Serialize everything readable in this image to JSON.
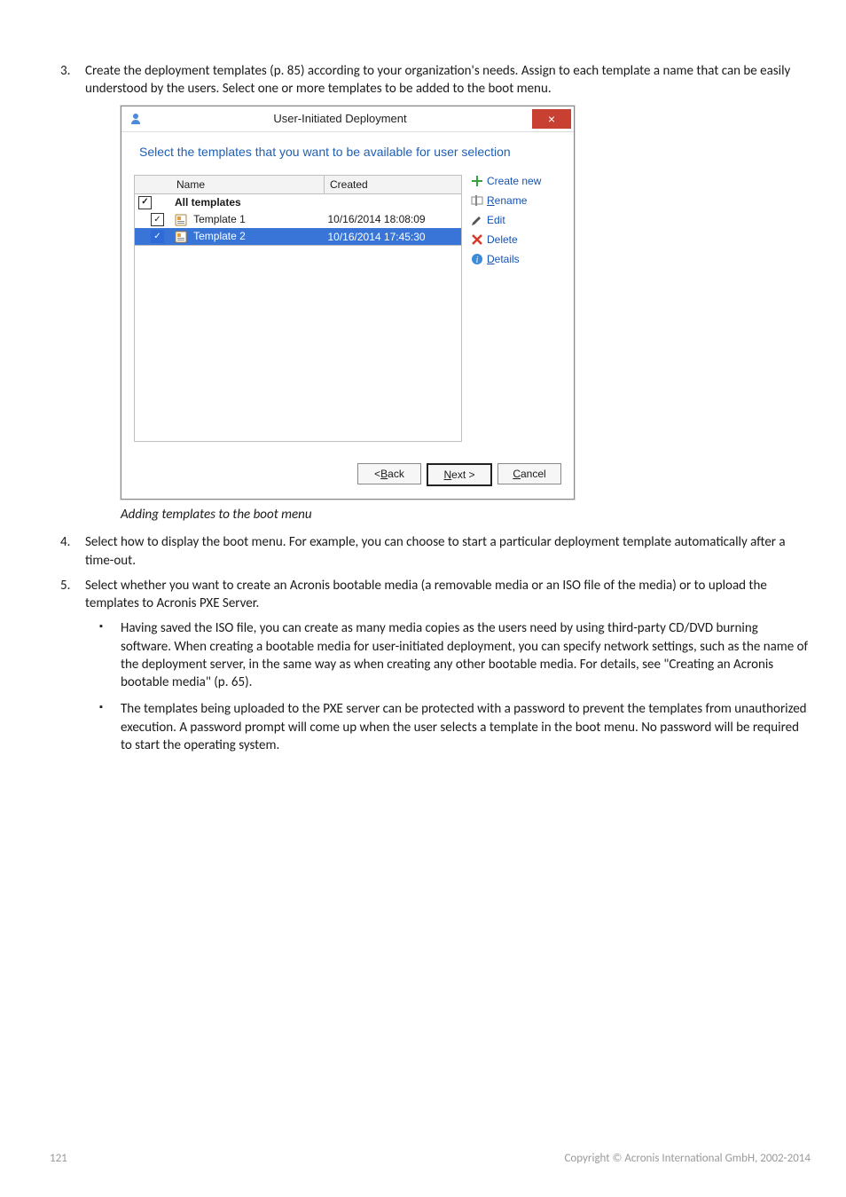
{
  "step3": {
    "num": "3.",
    "text": "Create the deployment templates (p. 85) according to your organization's needs. Assign to each template a name that can be easily understood by the users. Select one or more templates to be added to the boot menu."
  },
  "dialog": {
    "title": "User-Initiated Deployment",
    "closeGlyph": "×",
    "subtitle": "Select the templates that you want to be available for user selection",
    "headers": {
      "name": "Name",
      "created": "Created"
    },
    "rows": {
      "all": {
        "label": "All templates"
      },
      "r1": {
        "name": "Template 1",
        "created": "10/16/2014 18:08:09"
      },
      "r2": {
        "name": "Template 2",
        "created": "10/16/2014 17:45:30"
      }
    },
    "side": {
      "createnew": "Create new",
      "rename": "Rename",
      "edit": "Edit",
      "delete": "Delete",
      "details": "Details"
    },
    "buttons": {
      "back": "< Back",
      "next": "Next >",
      "cancel": "Cancel"
    }
  },
  "caption": "Adding templates to the boot menu",
  "step4": {
    "num": "4.",
    "text": "Select how to display the boot menu. For example, you can choose to start a particular deployment template automatically after a time-out."
  },
  "step5": {
    "num": "5.",
    "text": "Select whether you want to create an Acronis bootable media (a removable media or an ISO file of the media) or to upload the templates to Acronis PXE Server."
  },
  "bullets": {
    "b1": "Having saved the ISO file, you can create as many media copies as the users need by using third-party CD/DVD burning software. When creating a bootable media for user-initiated deployment, you can specify network settings, such as the name of the deployment server, in the same way as when creating any other bootable media. For details, see \"Creating an Acronis bootable media\" (p. 65).",
    "b2": "The templates being uploaded to the PXE server can be protected with a password to prevent the templates from unauthorized execution. A password prompt will come up when the user selects a template in the boot menu. No password will be required to start the operating system."
  },
  "footer": {
    "page": "121",
    "copyright": "Copyright © Acronis International GmbH, 2002-2014"
  }
}
